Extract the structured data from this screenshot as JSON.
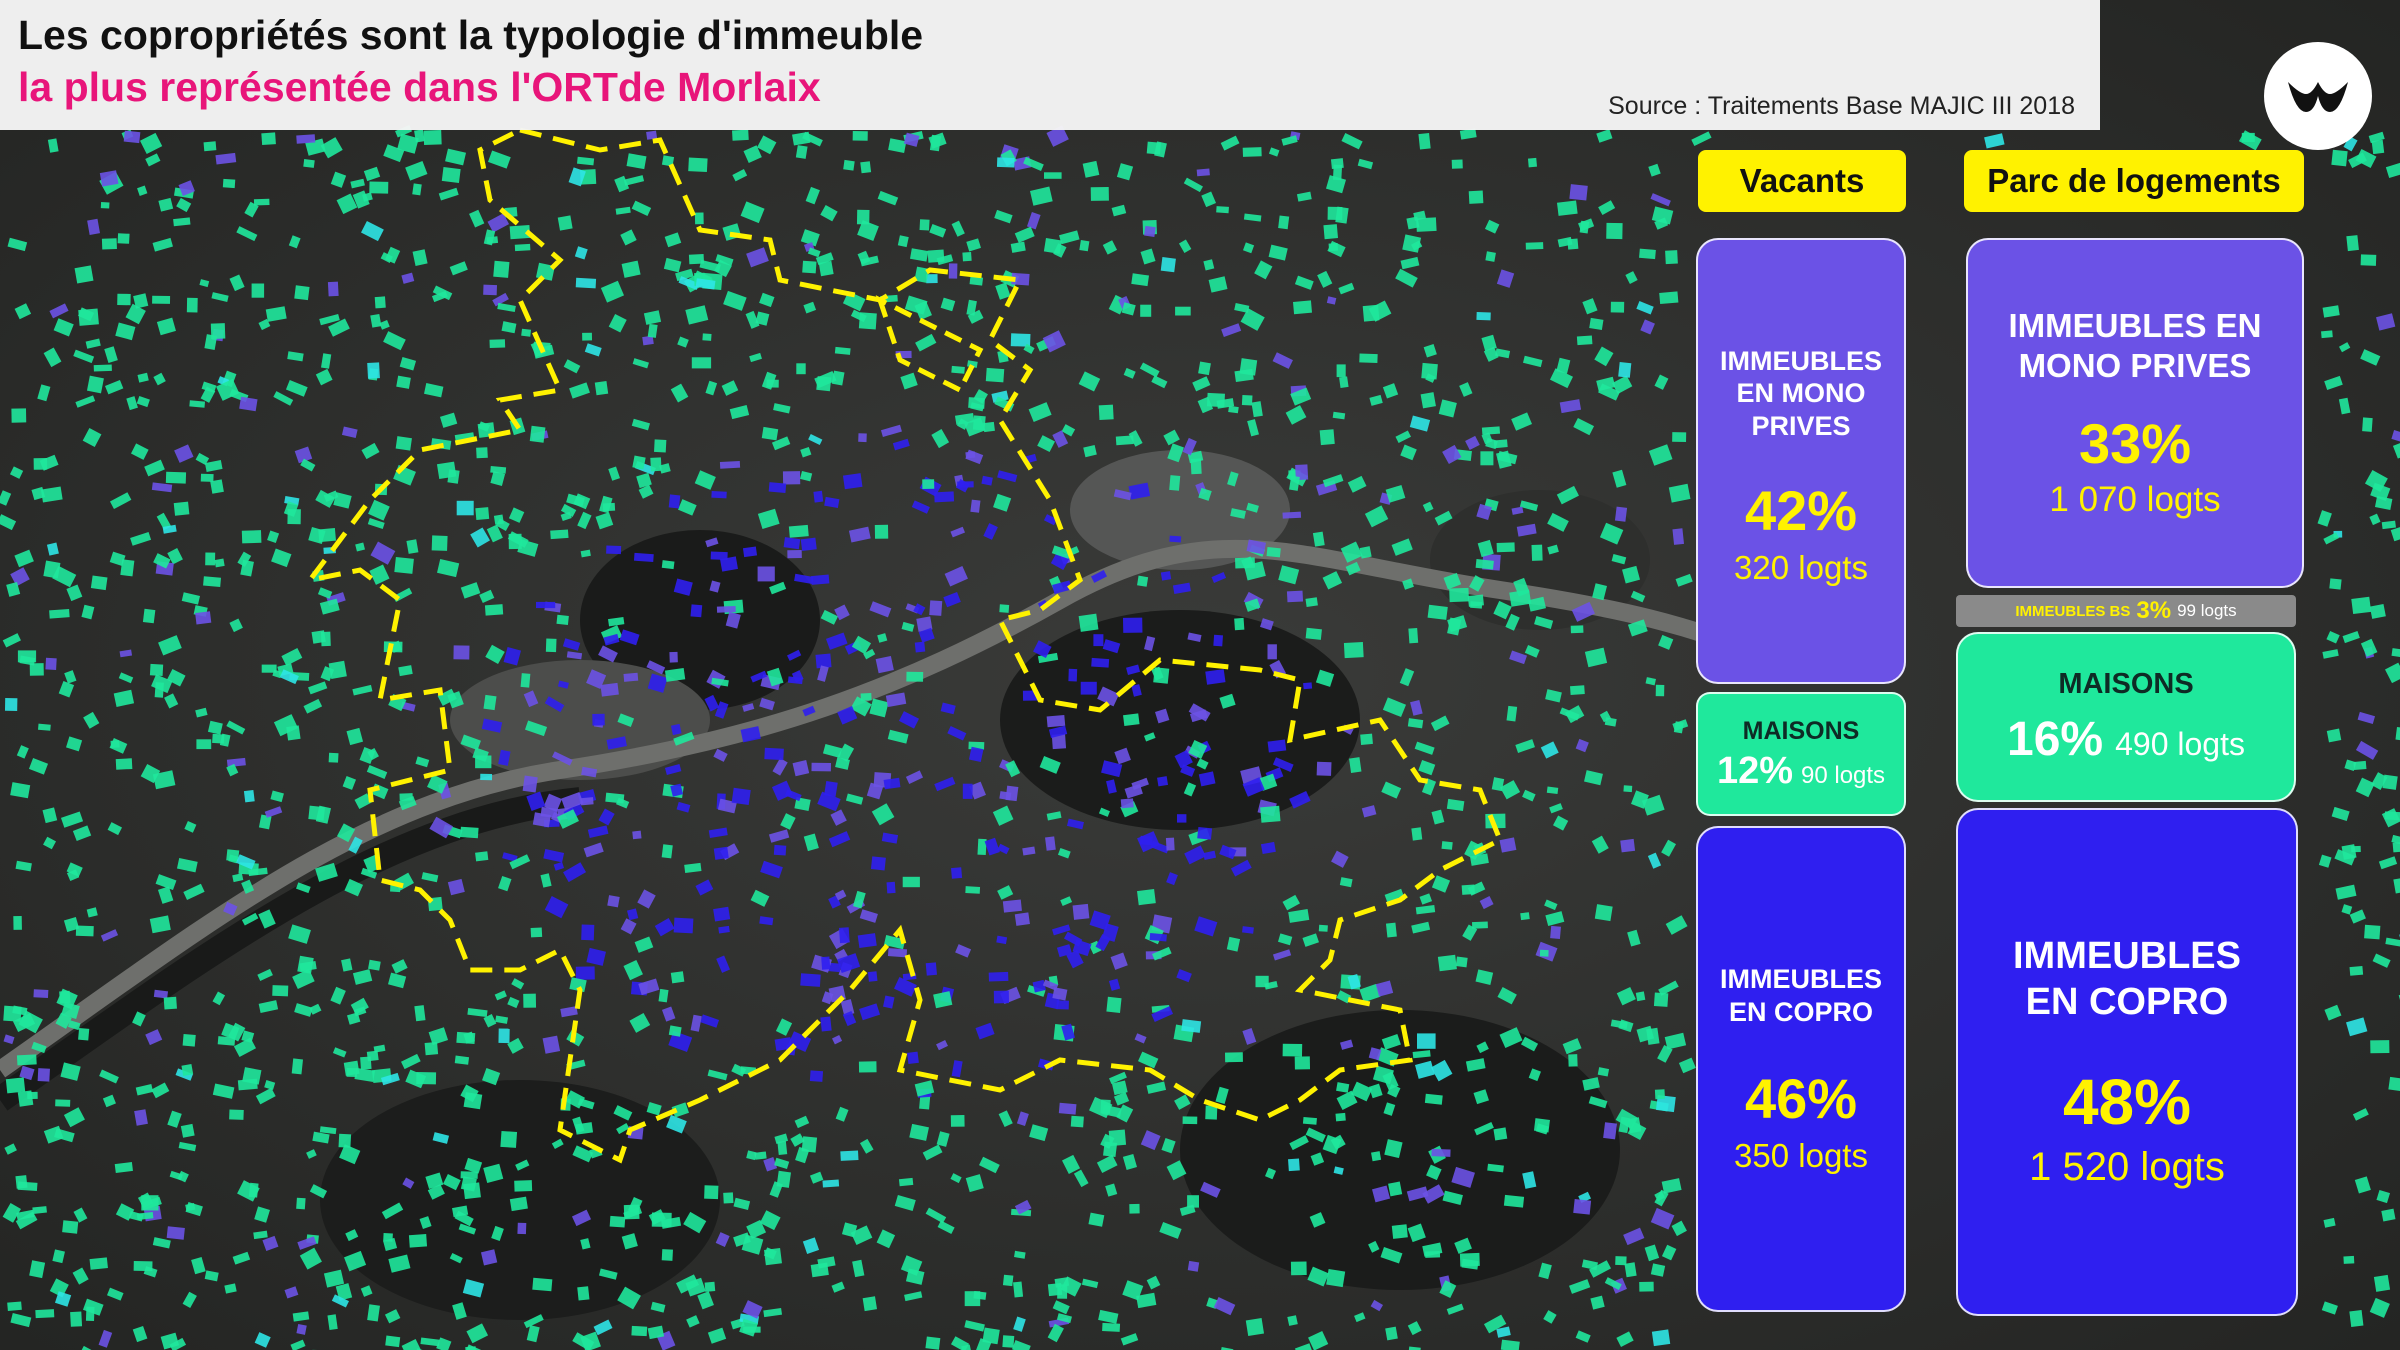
{
  "title": {
    "line1": "Les copropriétés sont la typologie d'immeuble",
    "line2": "la plus représentée dans l'ORTde Morlaix",
    "source": "Source : Traitements Base MAJIC III 2018"
  },
  "colors": {
    "mono": "#6b52e6",
    "copro": "#2f1ff0",
    "maison": "#1fe89c",
    "highlight": "#fff200",
    "ort_boundary": "#fff200",
    "title_accent": "#e8157a"
  },
  "vacants": {
    "header": "Vacants",
    "mono": {
      "label": "IMMEUBLES EN MONO PRIVES",
      "pct": "42%",
      "count": "320 logts"
    },
    "maisons": {
      "label": "MAISONS",
      "pct": "12%",
      "count": "90 logts"
    },
    "copro": {
      "label": "IMMEUBLES EN COPRO",
      "pct": "46%",
      "count": "350 logts"
    }
  },
  "parc": {
    "header": "Parc de logements",
    "mono": {
      "label": "IMMEUBLES EN MONO PRIVES",
      "pct": "33%",
      "count": "1 070 logts"
    },
    "bs": {
      "label": "IMMEUBLES BS",
      "pct": "3%",
      "count": "99 logts"
    },
    "maisons": {
      "label": "MAISONS",
      "pct": "16%",
      "count": "490 logts"
    },
    "copro": {
      "label": "IMMEUBLES EN COPRO",
      "pct": "48%",
      "count": "1 520 logts"
    }
  },
  "logo": {
    "icon": "brand-logo-icon"
  }
}
